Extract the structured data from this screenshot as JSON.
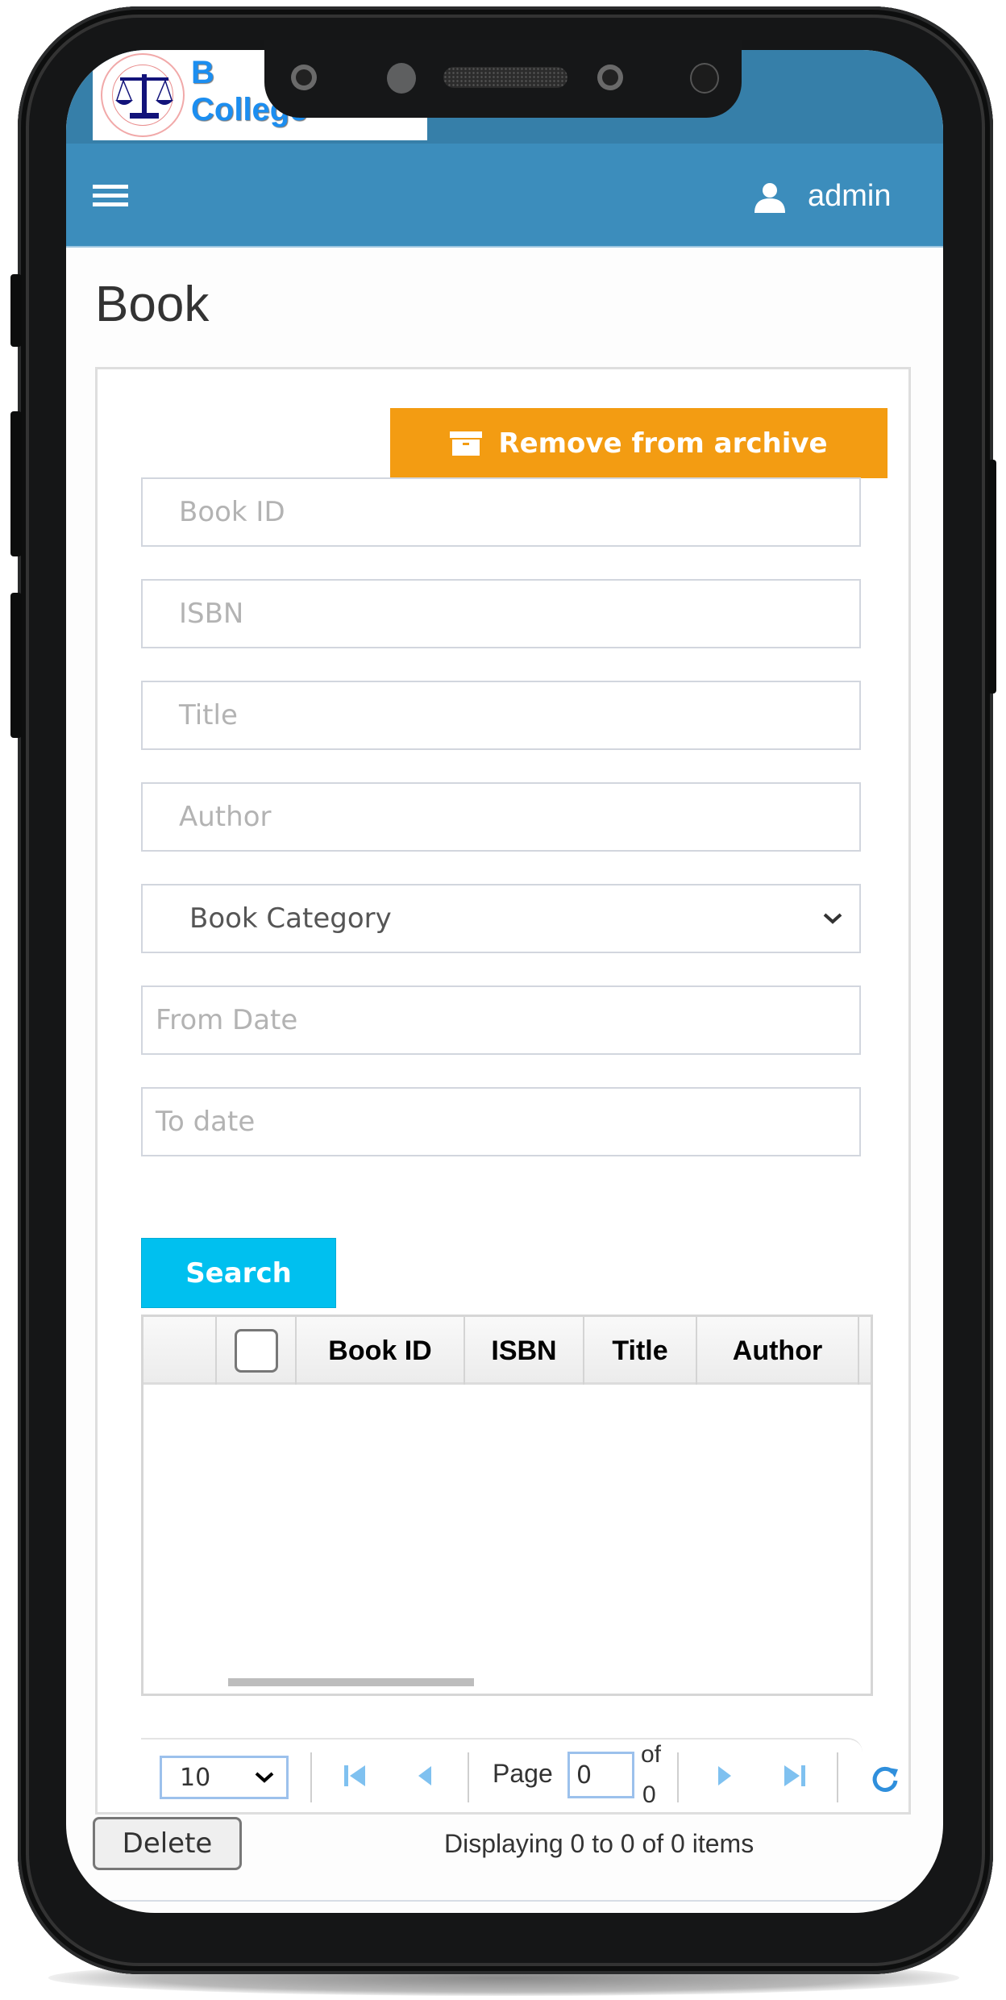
{
  "header": {
    "logo_text_line1": "B",
    "logo_text_line2": "College",
    "user_name": "admin"
  },
  "page": {
    "title": "Book"
  },
  "actions": {
    "remove_from_archive_label": "Remove from archive",
    "search_label": "Search",
    "delete_label": "Delete"
  },
  "filters": {
    "book_id_placeholder": "Book ID",
    "isbn_placeholder": "ISBN",
    "title_placeholder": "Title",
    "author_placeholder": "Author",
    "category_selected": "Book Category",
    "from_date_placeholder": "From Date",
    "to_date_placeholder": "To date"
  },
  "table": {
    "columns": [
      "",
      "",
      "Book ID",
      "ISBN",
      "Title",
      "Author"
    ],
    "rows": []
  },
  "pager": {
    "page_size": "10",
    "page_label": "Page",
    "current_page": "0",
    "of_label": "of",
    "total_pages": "0",
    "display_info": "Displaying 0 to 0 of 0 items"
  },
  "icons": {
    "menu": "hamburger-icon",
    "user": "user-icon",
    "archive": "archive-box-icon",
    "dropdown": "chevron-down-icon",
    "first": "first-page-icon",
    "prev": "prev-page-icon",
    "next": "next-page-icon",
    "last": "last-page-icon",
    "refresh": "refresh-icon"
  },
  "colors": {
    "navbar": "#3c8dbc",
    "topband": "#367fa9",
    "archive_button": "#f39c12",
    "search_button": "#00c0ef",
    "pager_icon": "#7fc1f0"
  }
}
